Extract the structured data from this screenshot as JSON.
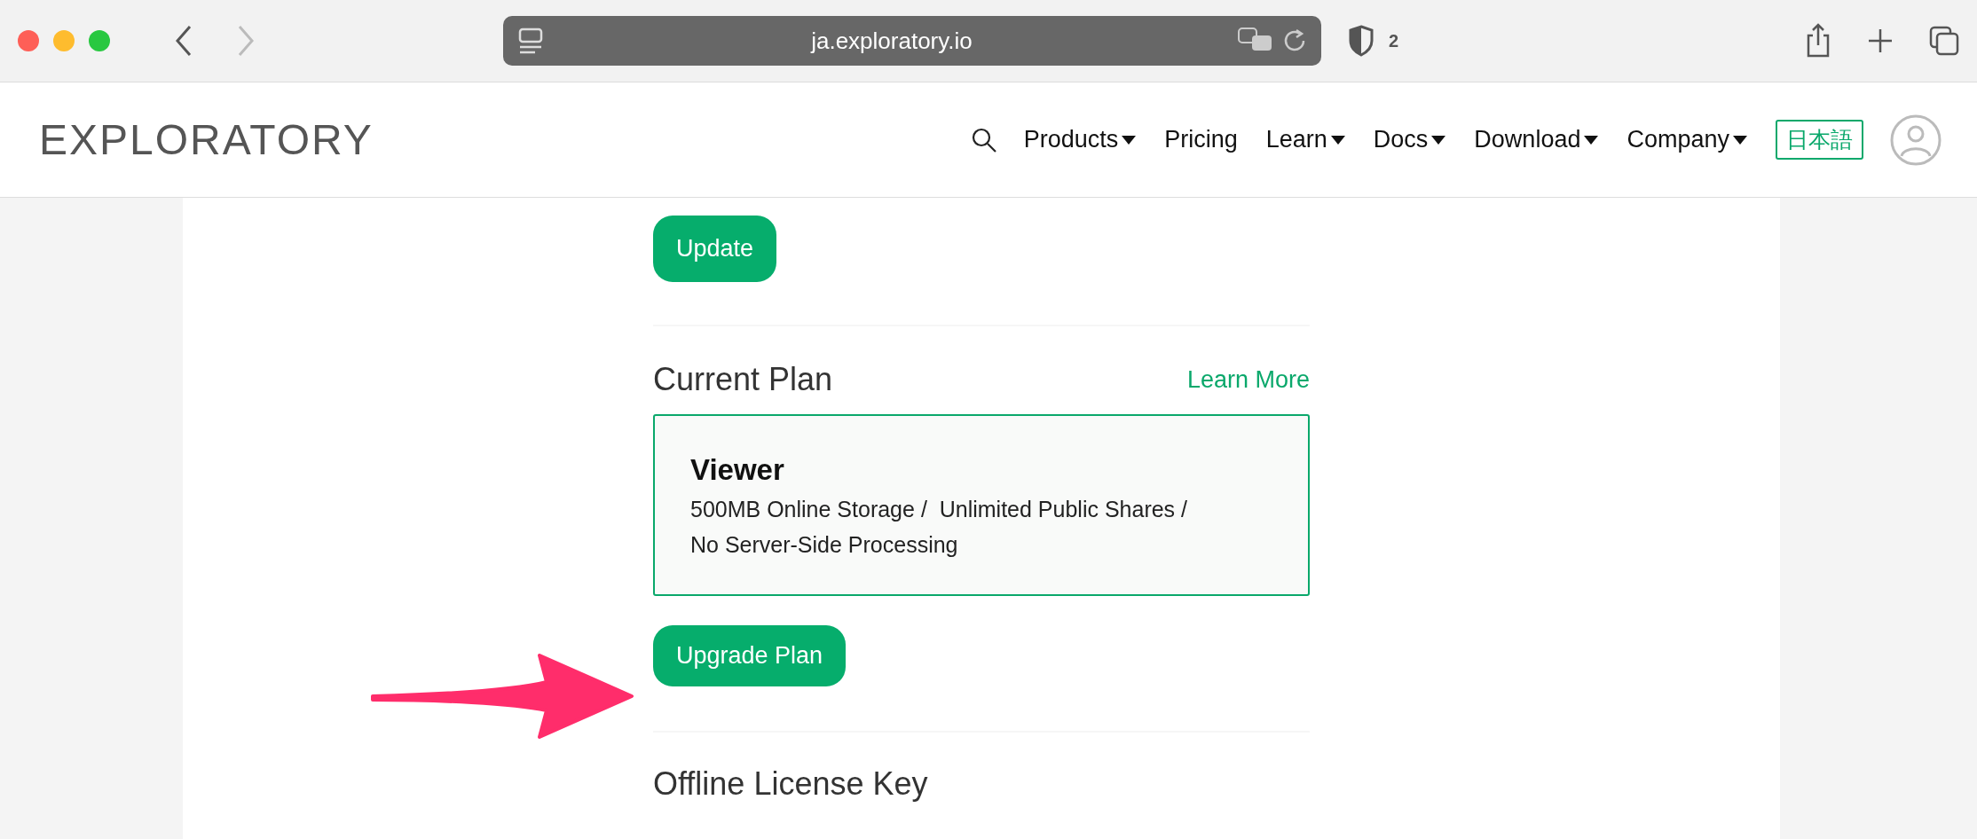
{
  "browser": {
    "url": "ja.exploratory.io",
    "tracker_count": "2",
    "back_enabled": true,
    "forward_enabled": false
  },
  "header": {
    "logo": "EXPLORATORY",
    "nav_items": [
      {
        "label": "Products",
        "has_dropdown": true
      },
      {
        "label": "Pricing",
        "has_dropdown": false
      },
      {
        "label": "Learn",
        "has_dropdown": true
      },
      {
        "label": "Docs",
        "has_dropdown": true
      },
      {
        "label": "Download",
        "has_dropdown": true
      },
      {
        "label": "Company",
        "has_dropdown": true
      }
    ],
    "language": "日本語"
  },
  "content": {
    "update_button": "Update",
    "current_plan": {
      "title": "Current Plan",
      "learn_more": "Learn More",
      "plan_name": "Viewer",
      "plan_details": [
        "500MB Online Storage /  Unlimited Public Shares /",
        "No Server-Side Processing"
      ]
    },
    "upgrade_button": "Upgrade Plan",
    "offline_title": "Offline License Key"
  }
}
